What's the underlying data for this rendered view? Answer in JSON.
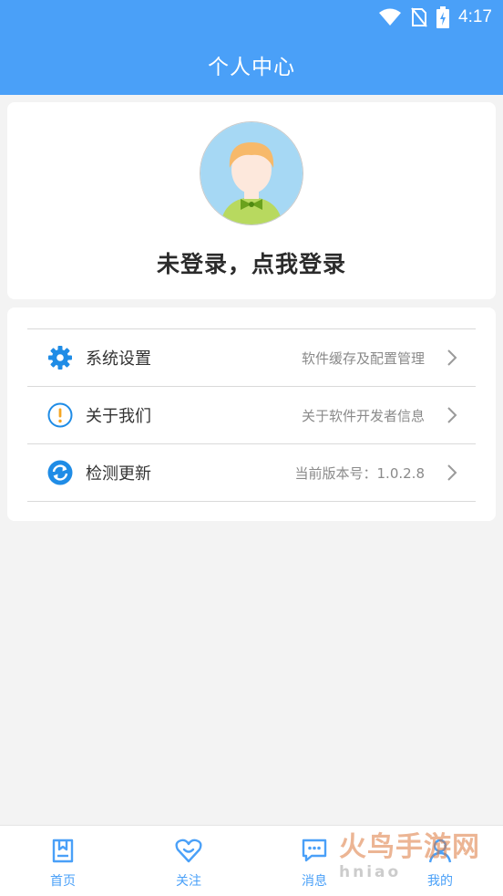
{
  "status_bar": {
    "time": "4:17",
    "icons": [
      "wifi-icon",
      "no-sim-icon",
      "battery-charging-icon"
    ]
  },
  "header": {
    "title": "个人中心"
  },
  "profile": {
    "login_prompt": "未登录，点我登录",
    "avatar_icon": "avatar-icon"
  },
  "menu": {
    "items": [
      {
        "label": "系统设置",
        "desc": "软件缓存及配置管理",
        "icon": "gear-icon"
      },
      {
        "label": "关于我们",
        "desc": "关于软件开发者信息",
        "icon": "info-icon"
      },
      {
        "label": "检测更新",
        "desc": "当前版本号：1.0.2.8",
        "icon": "refresh-icon"
      }
    ]
  },
  "bottom_nav": {
    "items": [
      {
        "label": "首页",
        "icon": "home-icon"
      },
      {
        "label": "关注",
        "icon": "heart-icon"
      },
      {
        "label": "消息",
        "icon": "message-icon"
      },
      {
        "label": "我的",
        "icon": "profile-icon"
      }
    ]
  },
  "watermark": {
    "text": "火鸟手游网",
    "domain": "hniao"
  },
  "colors": {
    "primary": "#4aa0f8",
    "background": "#f3f3f3",
    "text_secondary": "#8a8a8a"
  }
}
